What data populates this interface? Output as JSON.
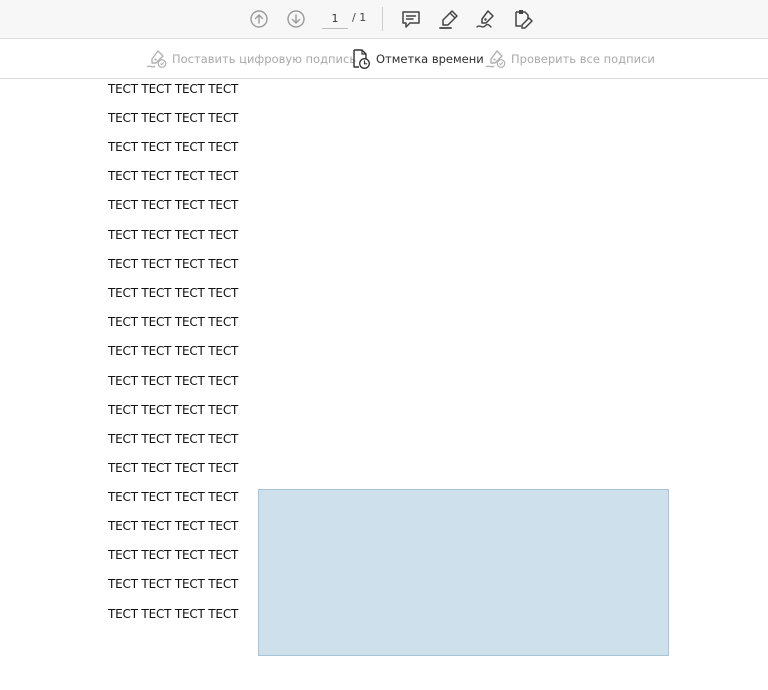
{
  "toolbar": {
    "page_current": "1",
    "page_total": "/ 1",
    "icons": [
      "prev-page-icon",
      "next-page-icon",
      "comment-icon",
      "highlight-icon",
      "sign-icon",
      "fill-sign-icon"
    ]
  },
  "sign_toolbar": {
    "digital_signature_label": "Поставить цифровую подпись",
    "timestamp_label": "Отметка времени",
    "verify_label": "Проверить все подписи"
  },
  "colors": {
    "toolbar_bg": "#f7f7f7",
    "signature_field_bg": "#cde0ec",
    "signature_field_border": "#a9c4d6",
    "disabled_text": "#a9a9a9"
  },
  "document": {
    "lines": [
      "ТЕСТ ТЕСТ ТЕСТ ТЕСТ",
      "ТЕСТ ТЕСТ ТЕСТ ТЕСТ",
      "ТЕСТ ТЕСТ ТЕСТ ТЕСТ",
      "ТЕСТ ТЕСТ ТЕСТ ТЕСТ",
      "ТЕСТ ТЕСТ ТЕСТ ТЕСТ",
      "ТЕСТ ТЕСТ ТЕСТ ТЕСТ",
      "ТЕСТ ТЕСТ ТЕСТ ТЕСТ",
      "ТЕСТ ТЕСТ ТЕСТ ТЕСТ",
      "ТЕСТ ТЕСТ ТЕСТ ТЕСТ",
      "ТЕСТ ТЕСТ ТЕСТ ТЕСТ",
      "ТЕСТ ТЕСТ ТЕСТ ТЕСТ",
      "ТЕСТ ТЕСТ ТЕСТ ТЕСТ",
      "ТЕСТ ТЕСТ ТЕСТ ТЕСТ",
      "ТЕСТ ТЕСТ ТЕСТ ТЕСТ",
      "ТЕСТ ТЕСТ ТЕСТ ТЕСТ",
      "ТЕСТ ТЕСТ ТЕСТ ТЕСТ",
      "ТЕСТ ТЕСТ ТЕСТ ТЕСТ",
      "ТЕСТ ТЕСТ ТЕСТ ТЕСТ",
      "ТЕСТ ТЕСТ ТЕСТ ТЕСТ"
    ]
  }
}
